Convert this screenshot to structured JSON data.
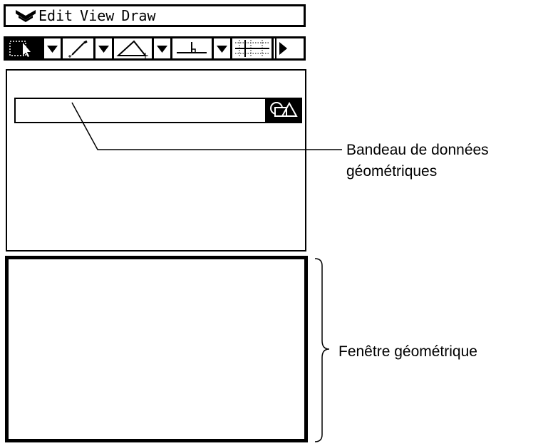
{
  "menu": {
    "items": [
      "Edit",
      "View",
      "Draw"
    ],
    "menu_icon": "double-chevron-down-icon"
  },
  "toolbar": {
    "tools": [
      {
        "name": "select-tool",
        "icon": "pointer-selection-icon",
        "active": true
      },
      {
        "name": "select-dropdown",
        "icon": "dropdown-arrow-icon"
      },
      {
        "name": "pen-tool",
        "icon": "pencil-draw-icon"
      },
      {
        "name": "pen-dropdown",
        "icon": "dropdown-arrow-icon"
      },
      {
        "name": "triangle-tool",
        "icon": "triangle-icon"
      },
      {
        "name": "triangle-dropdown",
        "icon": "dropdown-arrow-icon"
      },
      {
        "name": "perpendicular-tool",
        "icon": "perpendicular-icon"
      },
      {
        "name": "perpendicular-dropdown",
        "icon": "dropdown-arrow-icon"
      },
      {
        "name": "grid-tool",
        "icon": "grid-icon"
      },
      {
        "name": "scroll-right",
        "icon": "play-right-icon"
      }
    ]
  },
  "measurement_bar": {
    "value": "",
    "button_icon": "shapes-measure-icon"
  },
  "callouts": {
    "data_bar_line1": "Bandeau de données",
    "data_bar_line2": "géométriques",
    "geometry_window": "Fenêtre géométrique"
  },
  "colors": {
    "foreground": "#000000",
    "background": "#ffffff"
  }
}
